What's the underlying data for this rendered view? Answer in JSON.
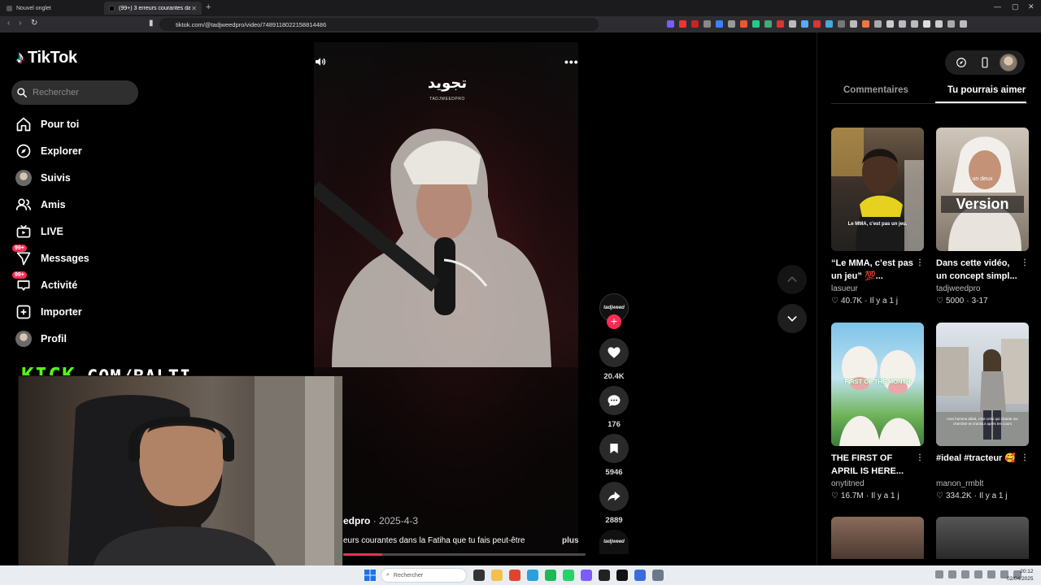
{
  "browser": {
    "tabs": [
      {
        "label": "Nouvel onglet"
      },
      {
        "label": "(99+) 3 erreurs courantes dans la"
      }
    ],
    "url": "tiktok.com/@tadjweedpro/video/7489118022158814486"
  },
  "tiktok": {
    "brand": "TikTok",
    "search_placeholder": "Rechercher",
    "nav": [
      {
        "label": "Pour toi"
      },
      {
        "label": "Explorer"
      },
      {
        "label": "Suivis"
      },
      {
        "label": "Amis"
      },
      {
        "label": "LIVE"
      },
      {
        "label": "Messages",
        "badge": "99+"
      },
      {
        "label": "Activité",
        "badge": "99+"
      },
      {
        "label": "Importer"
      },
      {
        "label": "Profil"
      }
    ]
  },
  "overlay": {
    "kick_brand": "KICK",
    "kick_rest": ".COM/BALTI"
  },
  "video": {
    "author": "edpro",
    "date": "2025-4-3",
    "description": "eurs courantes dans la Fatiha que tu fais peut-être",
    "more_label": "plus",
    "watermark_arabic": "تجويد",
    "watermark_latin": "TADJWEEDPRO",
    "progress_fraction": 0.16
  },
  "actions": {
    "likes": "20.4K",
    "comments": "176",
    "saves": "5946",
    "shares": "2889",
    "author_badge": "tadjweed"
  },
  "right_panel": {
    "tab_comments": "Commentaires",
    "tab_suggested": "Tu pourrais aimer",
    "cards": [
      {
        "title": "“Le MMA, c’est pas un jeu” 💯...",
        "author": "lasueur",
        "views": "40.7K",
        "ago": "Il y a 1 j",
        "thumb_caption": "Le MMA, c'est pas un jeu."
      },
      {
        "title": "Dans cette vidéo, un concept simpl...",
        "author": "tadjweedpro",
        "views": "5000",
        "ago": "3-17",
        "thumb_caption": "Version",
        "thumb_caption_small": "un deux"
      },
      {
        "title": "THE FIRST OF APRIL IS HERE...",
        "author": "onytitned",
        "views": "16.7M",
        "ago": "Il y a 1 j",
        "thumb_caption": "FIRST OF THE MONTH"
      },
      {
        "title": "#ideal #tracteur 🥰",
        "author": "manon_rmblt",
        "views": "334.2K",
        "ago": "Il y a 1 j",
        "thumb_caption": "mon homme idéal, c'est celui qui chante me chercher en tracteur après les cours"
      }
    ]
  },
  "taskbar": {
    "search_placeholder": "Rechercher",
    "time": "20:12",
    "date": "02/04/2025"
  },
  "colors": {
    "accent": "#fe2c55",
    "kick_green": "#53fc18",
    "tiktok_cyan": "#25f4ee"
  }
}
